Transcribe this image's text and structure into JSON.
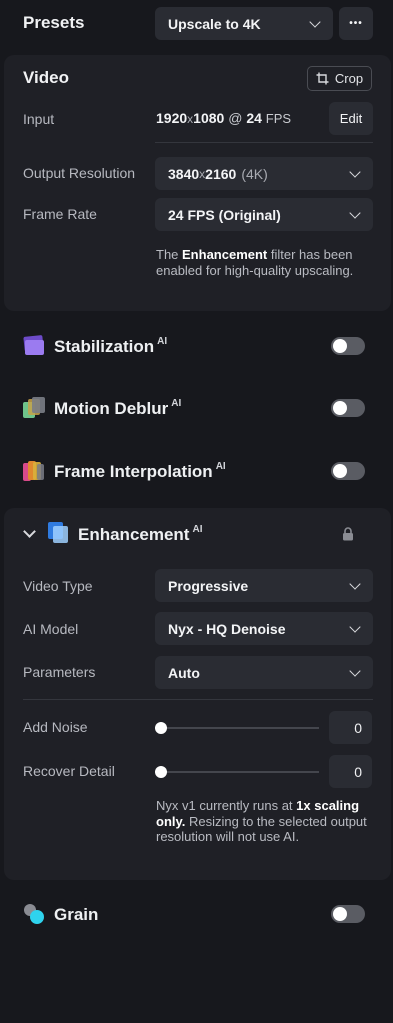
{
  "presets": {
    "title": "Presets",
    "selected": "Upscale to 4K",
    "more_label": "•••"
  },
  "video": {
    "title": "Video",
    "crop_label": "Crop",
    "input_label": "Input",
    "input_width": "1920",
    "input_height": "1080",
    "input_at": "@",
    "input_fps": "24",
    "input_fps_unit": "FPS",
    "edit_label": "Edit",
    "output_label": "Output Resolution",
    "output_width": "3840",
    "output_height": "2160",
    "output_suffix": "(4K)",
    "framerate_label": "Frame Rate",
    "framerate_value": "24 FPS (Original)",
    "note_pre": "The ",
    "note_bold": "Enhancement",
    "note_post": " filter has been enabled for high-quality upscaling."
  },
  "features": [
    {
      "name": "Stabilization",
      "ai": "AI",
      "enabled": false
    },
    {
      "name": "Motion Deblur",
      "ai": "AI",
      "enabled": false
    },
    {
      "name": "Frame Interpolation",
      "ai": "AI",
      "enabled": false
    }
  ],
  "enhancement": {
    "title": "Enhancement",
    "ai": "AI",
    "video_type_label": "Video Type",
    "video_type_value": "Progressive",
    "ai_model_label": "AI Model",
    "ai_model_value": "Nyx - HQ Denoise",
    "parameters_label": "Parameters",
    "parameters_value": "Auto",
    "add_noise_label": "Add Noise",
    "add_noise_value": "0",
    "recover_detail_label": "Recover Detail",
    "recover_detail_value": "0",
    "note_pre": "Nyx v1 currently runs at ",
    "note_bold": "1x scaling only.",
    "note_post": " Resizing to the selected output resolution will not use AI."
  },
  "grain": {
    "name": "Grain",
    "enabled": false
  },
  "colors": {
    "background": "#17181d",
    "panel": "#1f2026",
    "control": "#2a2c33",
    "toggle_off": "#5a5c63",
    "accent_stabilization": "#8b5cf6",
    "accent_grain": "#22d3ee"
  }
}
